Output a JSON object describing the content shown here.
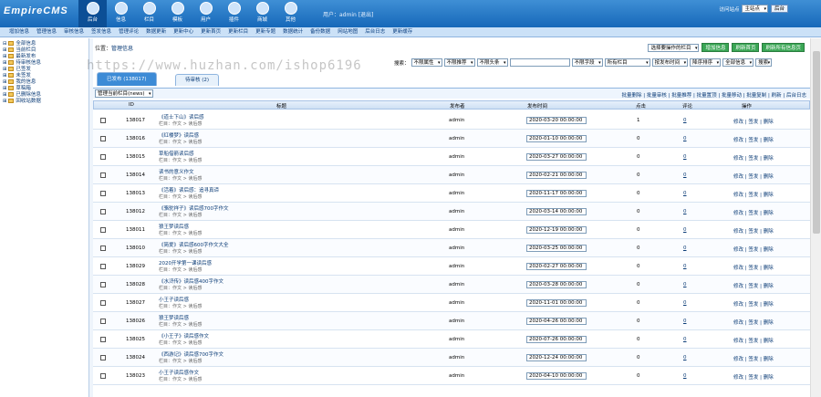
{
  "app": {
    "logo": "EmpireCMS",
    "user_text": "用户：admin  [退出]"
  },
  "topnav": [
    {
      "label": "后台"
    },
    {
      "label": "信息"
    },
    {
      "label": "栏目"
    },
    {
      "label": "模板"
    },
    {
      "label": "用户"
    },
    {
      "label": "插件"
    },
    {
      "label": "商城"
    },
    {
      "label": "其他"
    }
  ],
  "top_right": {
    "label": "访问站点",
    "select": "主站点",
    "button": "后台"
  },
  "menubar": [
    "增加信息",
    "管理信息",
    "审核信息",
    "签发信息",
    "管理评论",
    "数据更新",
    "更新中心",
    "更新首页",
    "更新栏目",
    "更新专题",
    "数据统计",
    "备份数据",
    "网站地图",
    "后台日志",
    "更新缓存"
  ],
  "sidebar": [
    {
      "label": "全部信息"
    },
    {
      "label": "当前栏目"
    },
    {
      "label": "最新发布"
    },
    {
      "label": "待审核信息"
    },
    {
      "label": "已签发"
    },
    {
      "label": "未签发"
    },
    {
      "label": "我的信息"
    },
    {
      "label": "草稿箱"
    },
    {
      "label": "已删除信息"
    },
    {
      "label": "回收站数据"
    }
  ],
  "location": {
    "prefix": "位置：",
    "path": "管理信息"
  },
  "actions": {
    "select": "选择要操作的栏目",
    "btn1": "增加信息",
    "btn2": "刷新首页",
    "btn3": "刷新所有信息页"
  },
  "search": {
    "label": "搜索：",
    "sel1": "不限属性",
    "sel2": "不限推荐",
    "sel3": "不限头条",
    "sel4": "不限字段",
    "sel5": "所有栏目",
    "sel6": "按发布时间",
    "sel7": "降序排序",
    "sel8": "全部信息",
    "button": "搜索"
  },
  "tabs": {
    "active": "已发布 (138017)",
    "inactive": "待审核 (2)"
  },
  "tools": {
    "select": "管理当前栏目(news)",
    "links": "批量删除 | 批量审核 | 批量推荐 | 批量置顶 | 批量移动 | 批量复制 | 刷新 | 后台日志"
  },
  "table": {
    "headers": [
      "ID",
      "标题",
      "发布者",
      "发布时间",
      "点击",
      "评论",
      "操作"
    ],
    "rows": [
      {
        "id": "138017",
        "title": "《道士下山》读后感",
        "sub": "栏目：作文 > 读后感",
        "author": "admin",
        "date": "2020-03-20 00:00:00",
        "clicks": "1",
        "comments": "0"
      },
      {
        "id": "138016",
        "title": "《红楼梦》读后感",
        "sub": "栏目：作文 > 读后感",
        "author": "admin",
        "date": "2020-01-10 00:00:00",
        "clicks": "0",
        "comments": "0"
      },
      {
        "id": "138015",
        "title": "草船借箭读后感",
        "sub": "栏目：作文 > 读后感",
        "author": "admin",
        "date": "2020-03-27 00:00:00",
        "clicks": "0",
        "comments": "0"
      },
      {
        "id": "138014",
        "title": "读书的意义作文",
        "sub": "栏目：作文 > 读后感",
        "author": "admin",
        "date": "2020-02-21 00:00:00",
        "clicks": "0",
        "comments": "0"
      },
      {
        "id": "138013",
        "title": "《活着》读后感：追寻真谛",
        "sub": "栏目：作文 > 读后感",
        "author": "admin",
        "date": "2020-11-17 00:00:00",
        "clicks": "0",
        "comments": "0"
      },
      {
        "id": "138012",
        "title": "《骆驼祥子》读后感700字作文",
        "sub": "栏目：作文 > 读后感",
        "author": "admin",
        "date": "2020-03-14 00:00:00",
        "clicks": "0",
        "comments": "0"
      },
      {
        "id": "138011",
        "title": "狼王梦读后感",
        "sub": "栏目：作文 > 读后感",
        "author": "admin",
        "date": "2020-12-19 00:00:00",
        "clicks": "0",
        "comments": "0"
      },
      {
        "id": "138010",
        "title": "《简爱》读后感600字作文大全",
        "sub": "栏目：作文 > 读后感",
        "author": "admin",
        "date": "2020-03-25 00:00:00",
        "clicks": "0",
        "comments": "0"
      },
      {
        "id": "138029",
        "title": "2020开学第一课读后感",
        "sub": "栏目：作文 > 读后感",
        "author": "admin",
        "date": "2020-02-27 00:00:00",
        "clicks": "0",
        "comments": "0"
      },
      {
        "id": "138028",
        "title": "《水浒传》读后感400字作文",
        "sub": "栏目：作文 > 读后感",
        "author": "admin",
        "date": "2020-03-28 00:00:00",
        "clicks": "0",
        "comments": "0"
      },
      {
        "id": "138027",
        "title": "小王子读后感",
        "sub": "栏目：作文 > 读后感",
        "author": "admin",
        "date": "2020-11-01 00:00:00",
        "clicks": "0",
        "comments": "0"
      },
      {
        "id": "138026",
        "title": "狼王梦读后感",
        "sub": "栏目：作文 > 读后感",
        "author": "admin",
        "date": "2020-04-26 00:00:00",
        "clicks": "0",
        "comments": "0"
      },
      {
        "id": "138025",
        "title": "《小王子》读后感作文",
        "sub": "栏目：作文 > 读后感",
        "author": "admin",
        "date": "2020-07-26 00:00:00",
        "clicks": "0",
        "comments": "0"
      },
      {
        "id": "138024",
        "title": "《西游记》读后感700字作文",
        "sub": "栏目：作文 > 读后感",
        "author": "admin",
        "date": "2020-12-24 00:00:00",
        "clicks": "0",
        "comments": "0"
      },
      {
        "id": "138023",
        "title": "小王子读后感作文",
        "sub": "栏目：作文 > 读后感",
        "author": "admin",
        "date": "2020-04-10 00:00:00",
        "clicks": "0",
        "comments": "0"
      }
    ],
    "ops": {
      "edit": "修改",
      "sign": "签发",
      "del": "删除"
    }
  },
  "watermark": "https://www.huzhan.com/ishop6196"
}
